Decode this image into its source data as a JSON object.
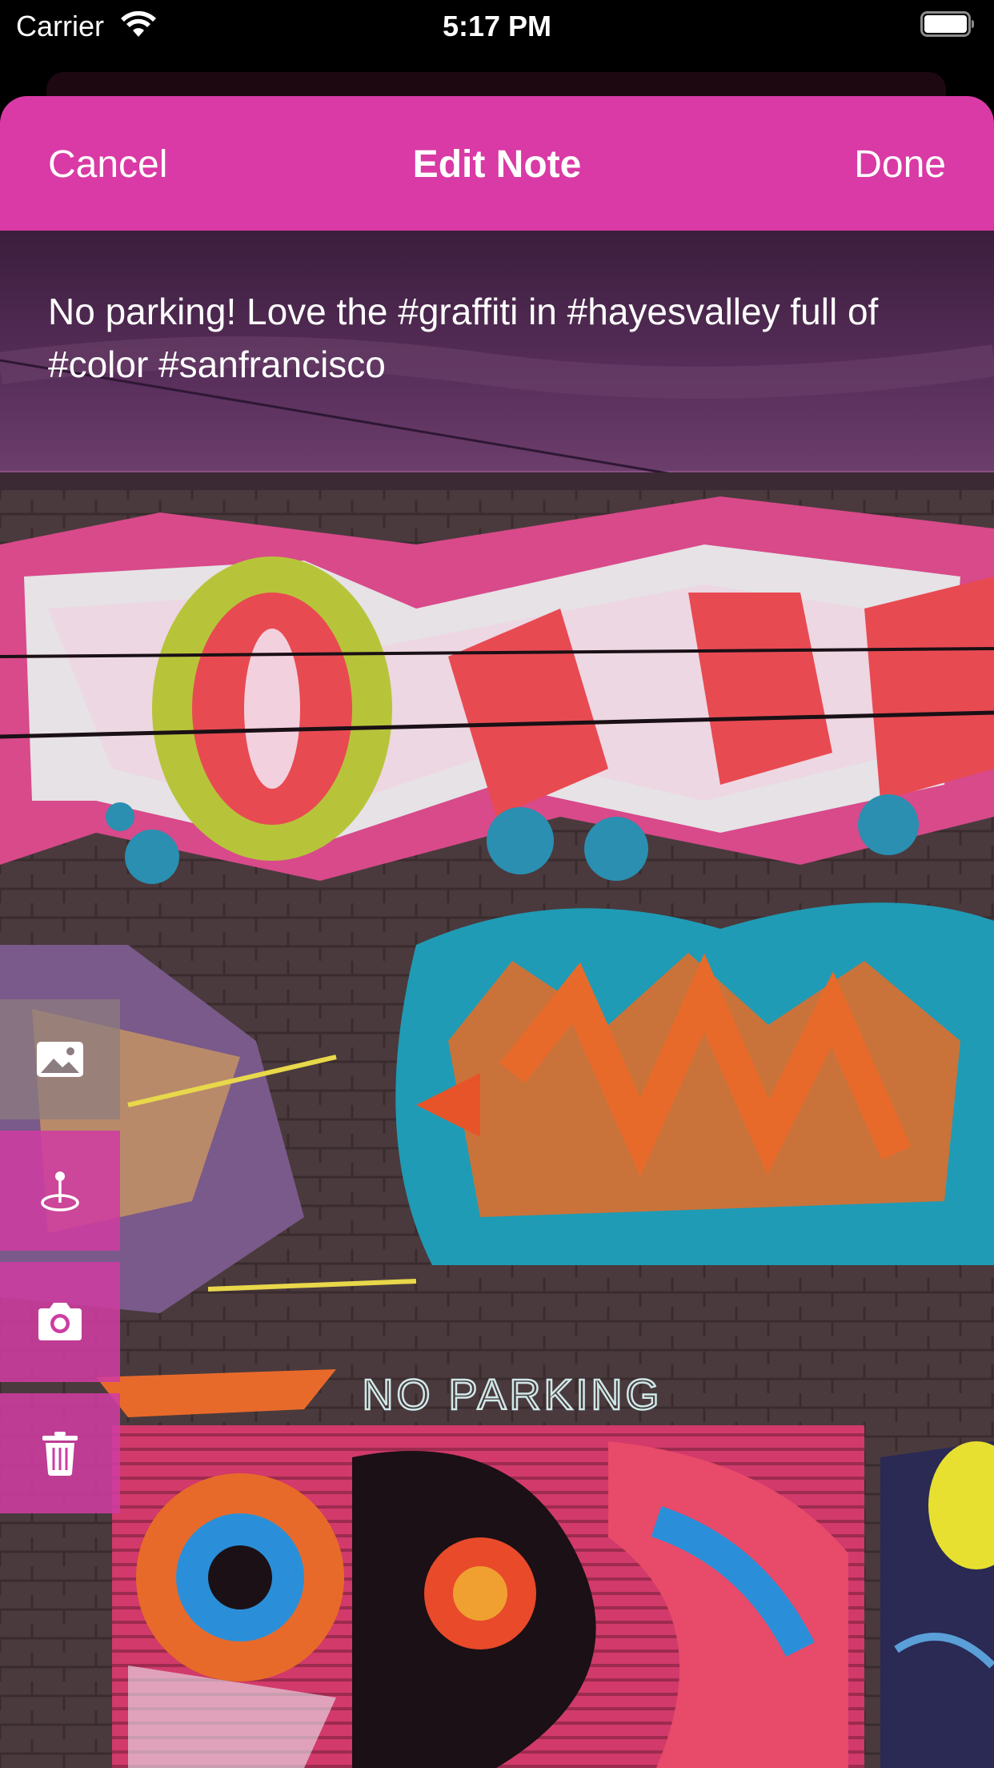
{
  "status_bar": {
    "carrier": "Carrier",
    "time": "5:17 PM"
  },
  "nav": {
    "cancel_label": "Cancel",
    "title": "Edit Note",
    "done_label": "Done"
  },
  "note": {
    "text": "No parking! Love the #graffiti in #hayesvalley full of #color #sanfrancisco"
  },
  "mural": {
    "sign_text": "NO PARKING"
  },
  "tools": [
    {
      "name": "photo",
      "icon": "photo-icon"
    },
    {
      "name": "location",
      "icon": "location-pin-icon"
    },
    {
      "name": "camera",
      "icon": "camera-icon"
    },
    {
      "name": "delete",
      "icon": "trash-icon"
    }
  ],
  "colors": {
    "accent": "#d93aa5",
    "sky_overlay": "#6b3a6e"
  }
}
